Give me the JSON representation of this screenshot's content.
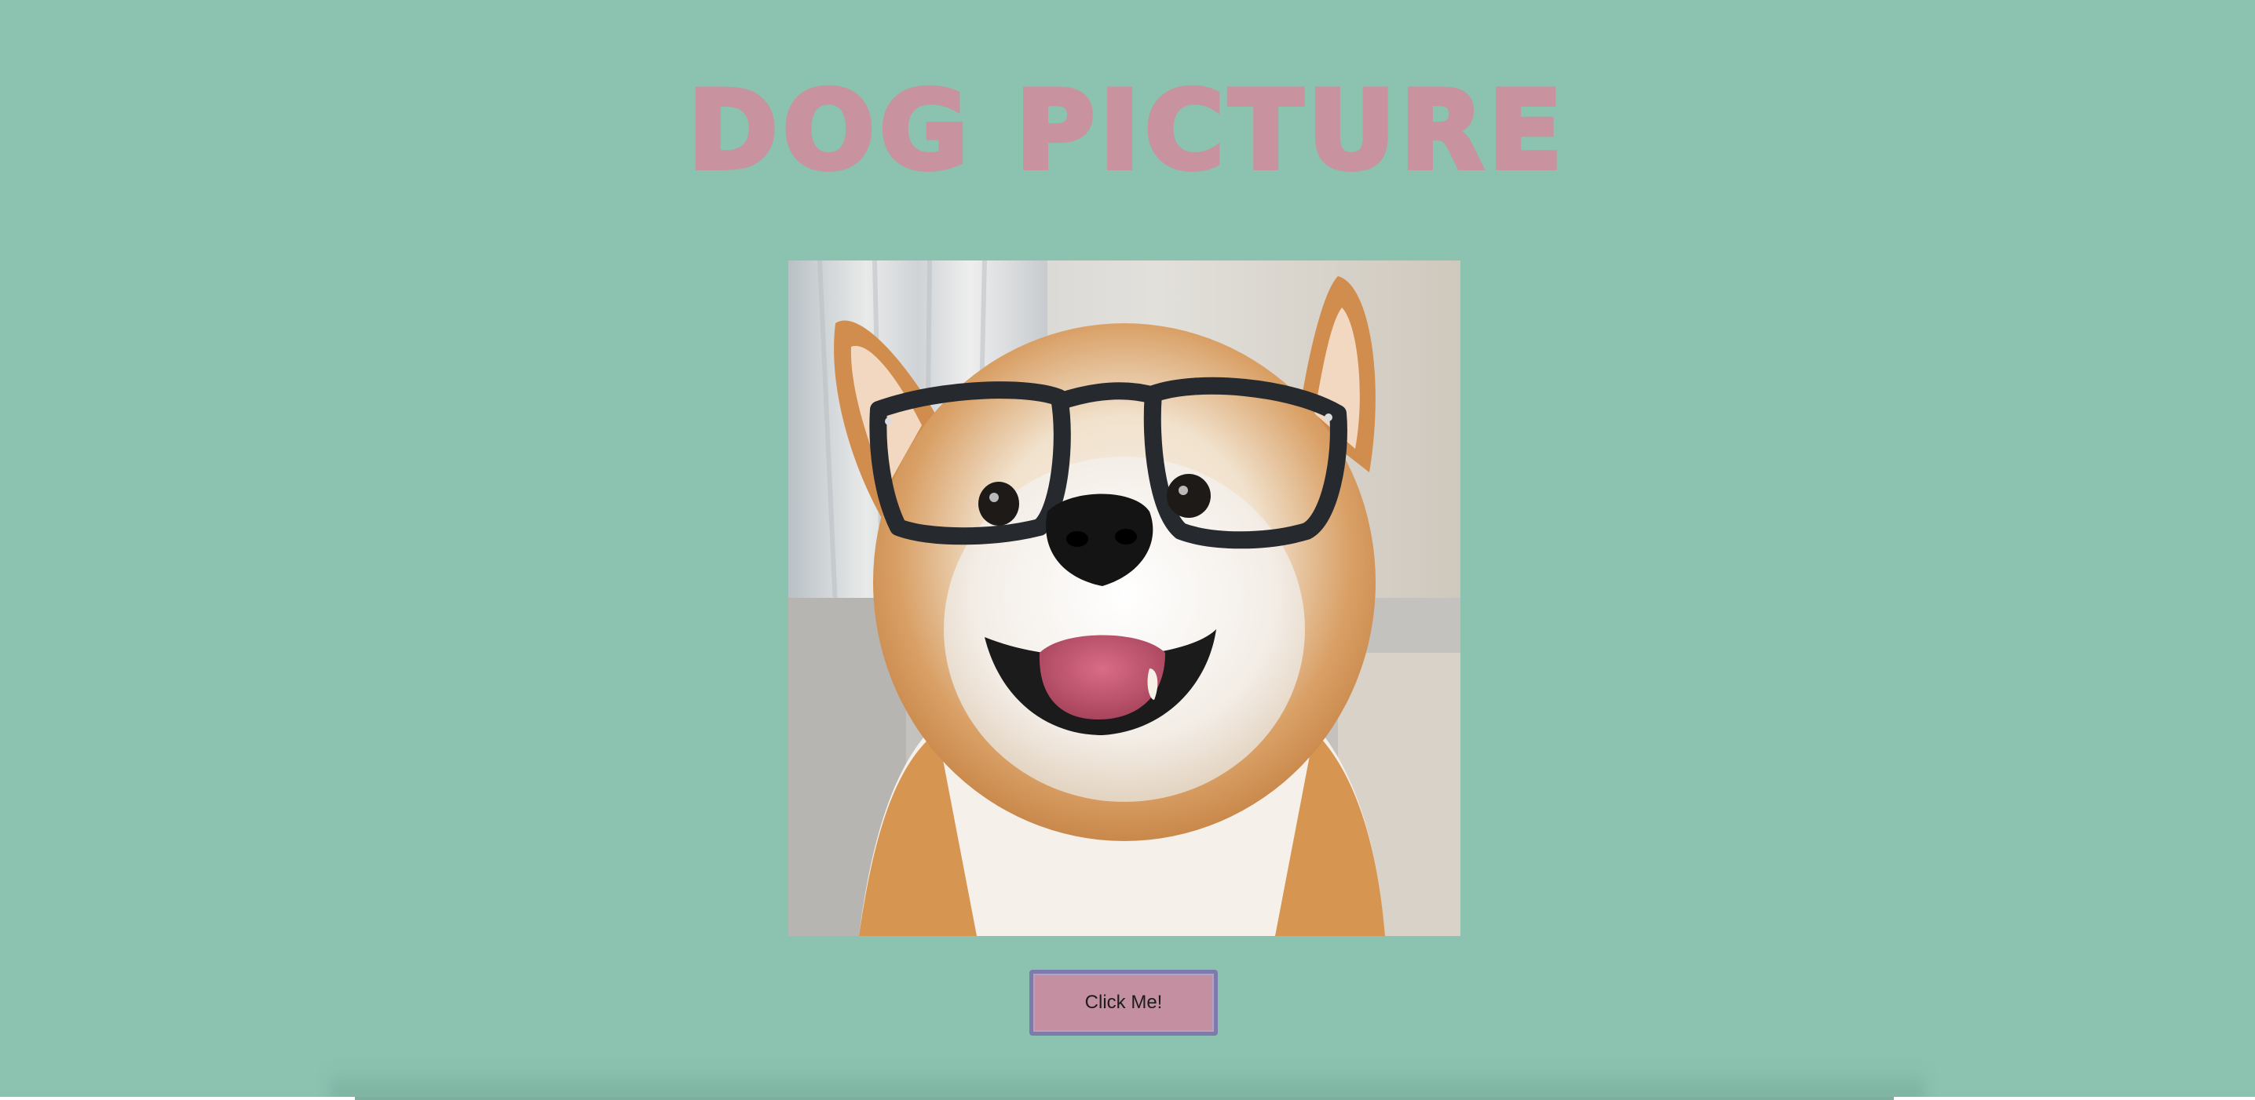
{
  "page": {
    "title": "DOG PICTURE",
    "background_color": "#8bc2b0",
    "title_color": "#c8929f"
  },
  "image": {
    "alt": "dog-picture",
    "description_icon": "shiba-inu-with-glasses-photo"
  },
  "button": {
    "label": "Click Me!",
    "fill_color": "#c48fa1",
    "border_color": "#7c7bab"
  }
}
